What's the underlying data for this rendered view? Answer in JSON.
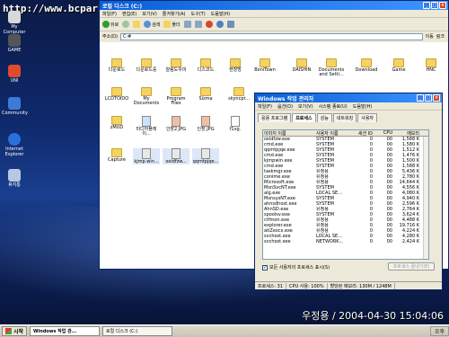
{
  "watermark": "http://www.bcpark.net",
  "desktop_icons": [
    {
      "label": "My Computer",
      "color": "#d8d8d8"
    },
    {
      "label": "GAME",
      "color": "#555"
    },
    {
      "label": "UNI",
      "color": "#e04b2e"
    },
    {
      "label": "Community",
      "color": "#3d7ad6"
    },
    {
      "label": "Internet Explorer",
      "color": "#2b6fdd"
    },
    {
      "label": "휴지통",
      "color": "#b8c8e0"
    }
  ],
  "explorer": {
    "title": "로컬 디스크 (C:)",
    "menu": [
      "파일(F)",
      "편집(E)",
      "보기(V)",
      "즐겨찾기(A)",
      "도구(T)",
      "도움말(H)"
    ],
    "toolbar": {
      "back": "뒤로",
      "forward": "",
      "up": "",
      "search": "검색",
      "folders": "폴더"
    },
    "address_label": "주소(D)",
    "address_value": "C:#",
    "go_label": "이동",
    "links_label": "링크",
    "items": [
      {
        "label": "다운로드",
        "kind": "folder"
      },
      {
        "label": "다운로드중",
        "kind": "folder"
      },
      {
        "label": "알림도우미",
        "kind": "folder"
      },
      {
        "label": "디스코드",
        "kind": "folder"
      },
      {
        "label": "현장방",
        "kind": "folder"
      },
      {
        "label": "BoniTown",
        "kind": "folder"
      },
      {
        "label": "DAISHIN",
        "kind": "folder"
      },
      {
        "label": "Documents and Setti...",
        "kind": "folder"
      },
      {
        "label": "Download",
        "kind": "folder"
      },
      {
        "label": "Game",
        "kind": "folder"
      },
      {
        "label": "HNC",
        "kind": "folder"
      },
      {
        "label": "LCDTOIDO",
        "kind": "folder"
      },
      {
        "label": "My Documents",
        "kind": "folder"
      },
      {
        "label": "Program Files",
        "kind": "folder"
      },
      {
        "label": "Sizma",
        "kind": "folder"
      },
      {
        "label": "skyncpr...",
        "kind": "folder"
      },
      {
        "label": "zMUD",
        "kind": "folder"
      },
      {
        "label": "미디어플레이...",
        "kind": "file"
      },
      {
        "label": "인장2.JPG",
        "kind": "file"
      },
      {
        "label": "인장.JPG",
        "kind": "file"
      },
      {
        "label": "f1vg.",
        "kind": "file"
      },
      {
        "label": "Capture",
        "kind": "folder"
      },
      {
        "label": "kjmp.win...",
        "kind": "file"
      },
      {
        "label": "oxidfzw...",
        "kind": "file"
      },
      {
        "label": "qqmtpjqe...",
        "kind": "file"
      }
    ]
  },
  "taskmgr": {
    "title": "Windows 작업 관리자",
    "menu": [
      "파일(F)",
      "옵션(O)",
      "보기(V)",
      "시스템 종료(U)",
      "도움말(H)"
    ],
    "tabs": [
      "응용 프로그램",
      "프로세스",
      "성능",
      "네트워킹",
      "사용자"
    ],
    "selected_tab": "프로세스",
    "columns": [
      "이미지 이름",
      "사용자 이름",
      "세션 ID",
      "CPU",
      "메모리"
    ],
    "rows": [
      [
        "oxidfzw.exe",
        "SYSTEM",
        "0",
        "00",
        "1,588 K"
      ],
      [
        "cmd.exe",
        "SYSTEM",
        "0",
        "00",
        "1,580 K"
      ],
      [
        "qqmtpjqe.exe",
        "SYSTEM",
        "0",
        "00",
        "1,512 K"
      ],
      [
        "cmd.exe",
        "SYSTEM",
        "0",
        "00",
        "1,476 K"
      ],
      [
        "kjmpwin.exe",
        "SYSTEM",
        "0",
        "00",
        "1,500 K"
      ],
      [
        "cmd.exe",
        "SYSTEM",
        "0",
        "00",
        "1,588 K"
      ],
      [
        "taskmgr.exe",
        "유정용",
        "0",
        "00",
        "5,436 K"
      ],
      [
        "conime.exe",
        "유정용",
        "0",
        "00",
        "2,780 K"
      ],
      [
        "Microsoft.exe",
        "유정용",
        "0",
        "00",
        "14,644 K"
      ],
      [
        "MsnSvcNT.exe",
        "SYSTEM",
        "0",
        "00",
        "4,556 K"
      ],
      [
        "alg.exe",
        "LOCAL SE...",
        "0",
        "00",
        "4,080 K"
      ],
      [
        "MsnsysNT.exe",
        "SYSTEM",
        "0",
        "00",
        "4,940 K"
      ],
      [
        "ahnsdhost.exe",
        "SYSTEM",
        "0",
        "00",
        "2,596 K"
      ],
      [
        "AhnSD.exe",
        "유정용",
        "0",
        "00",
        "2,764 K"
      ],
      [
        "spoolsv.exe",
        "SYSTEM",
        "0",
        "00",
        "3,624 K"
      ],
      [
        "ctfmon.exe",
        "유정용",
        "0",
        "00",
        "4,488 K"
      ],
      [
        "explorer.exe",
        "유정용",
        "0",
        "00",
        "19,716 K"
      ],
      [
        "atiZexcx.exe",
        "유정용",
        "0",
        "00",
        "4,224 K"
      ],
      [
        "svchost.exe",
        "LOCAL SE...",
        "0",
        "00",
        "4,280 K"
      ],
      [
        "svchost.exe",
        "NETWORK...",
        "0",
        "00",
        "2,424 K"
      ]
    ],
    "show_all_users": "모든 사용자의 프로세스 표시(S)",
    "end_process": "프로세스 끝내기(E)",
    "status": {
      "processes": "프로세스: 31",
      "cpu": "CPU 사용: 100%",
      "commit": "할당된 메모리: 130M / 1248M"
    }
  },
  "taskbar": {
    "start": "시작",
    "tasks": [
      "Windows 작업 관...",
      "로컬 디스크 (C:)"
    ],
    "clock": "오후"
  },
  "timestamp": "우정용 / 2004-04-30 15:04:06"
}
